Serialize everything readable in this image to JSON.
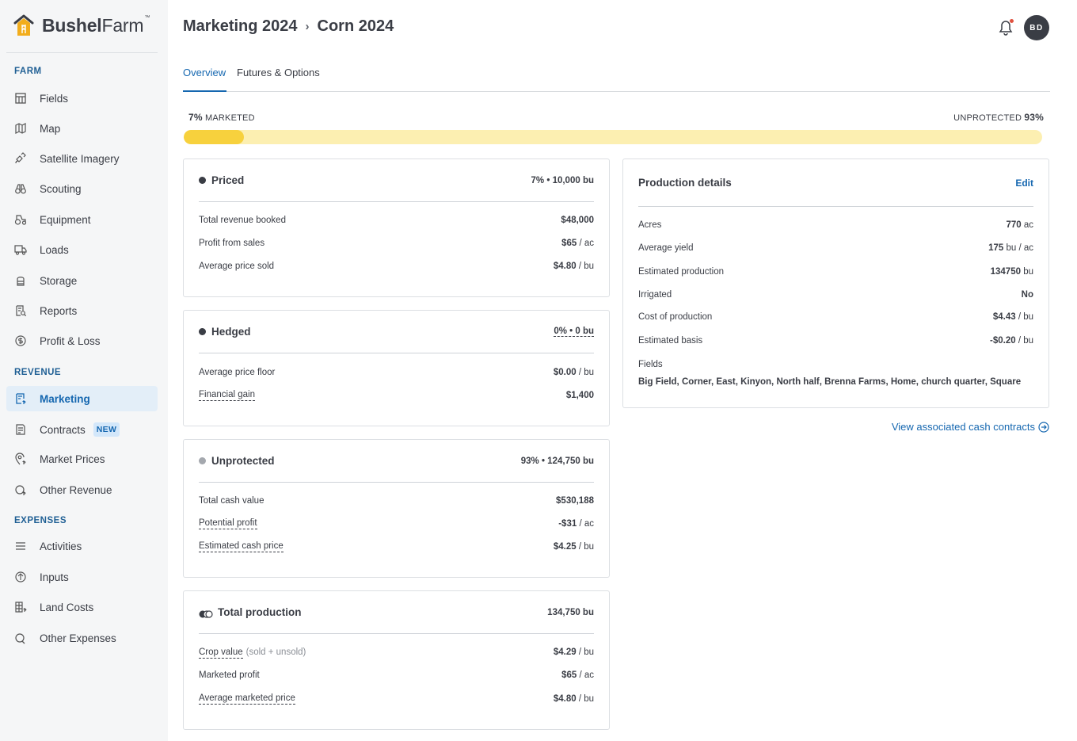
{
  "brand": {
    "name_bold": "Bushel",
    "name_light": "Farm",
    "tm": "™"
  },
  "sidebar": {
    "farm_title": "FARM",
    "farm_items": [
      "Fields",
      "Map",
      "Satellite Imagery",
      "Scouting",
      "Equipment",
      "Loads",
      "Storage",
      "Reports",
      "Profit & Loss"
    ],
    "revenue_title": "REVENUE",
    "revenue_items": [
      "Marketing",
      "Contracts",
      "Market Prices",
      "Other Revenue"
    ],
    "new_badge": "NEW",
    "expenses_title": "EXPENSES",
    "expenses_items": [
      "Activities",
      "Inputs",
      "Land Costs",
      "Other Expenses"
    ]
  },
  "header": {
    "crumb1": "Marketing 2024",
    "sep": "›",
    "crumb2": "Corn 2024",
    "avatar_initials": "BD"
  },
  "tabs": {
    "overview": "Overview",
    "futures": "Futures & Options"
  },
  "progress": {
    "marketed_pct": "7%",
    "marketed_label": "MARKETED",
    "unprotected_label": "UNPROTECTED",
    "unprotected_pct": "93%",
    "fill_fraction": 0.07
  },
  "priced": {
    "title": "Priced",
    "summary": "7% • 10,000 bu",
    "r1_label": "Total revenue booked",
    "r1_val": "$48,000",
    "r1_unit": "",
    "r2_label": "Profit from sales",
    "r2_val": "$65",
    "r2_unit": "/ ac",
    "r3_label": "Average price sold",
    "r3_val": "$4.80",
    "r3_unit": "/ bu"
  },
  "hedged": {
    "title": "Hedged",
    "summary": "0% • 0 bu",
    "r1_label": "Average price floor",
    "r1_val": "$0.00",
    "r1_unit": "/ bu",
    "r2_label": "Financial gain",
    "r2_val": "$1,400"
  },
  "unprotected": {
    "title": "Unprotected",
    "summary": "93% • 124,750 bu",
    "r1_label": "Total cash value",
    "r1_val": "$530,188",
    "r2_label": "Potential profit",
    "r2_val": "-$31",
    "r2_unit": "/ ac",
    "r3_label": "Estimated cash price",
    "r3_val": "$4.25",
    "r3_unit": "/ bu"
  },
  "total": {
    "title": "Total production",
    "summary": "134,750 bu",
    "r1_label": "Crop value",
    "r1_muted": "(sold + unsold)",
    "r1_val": "$4.29",
    "r1_unit": "/ bu",
    "r2_label": "Marketed profit",
    "r2_val": "$65",
    "r2_unit": "/ ac",
    "r3_label": "Average marketed price",
    "r3_val": "$4.80",
    "r3_unit": "/ bu"
  },
  "production": {
    "title": "Production details",
    "edit": "Edit",
    "acres_label": "Acres",
    "acres_val": "770",
    "acres_unit": "ac",
    "yield_label": "Average yield",
    "yield_val": "175",
    "yield_unit": "bu / ac",
    "est_label": "Estimated production",
    "est_val": "134750",
    "est_unit": "bu",
    "irr_label": "Irrigated",
    "irr_val": "No",
    "cost_label": "Cost of production",
    "cost_val": "$4.43",
    "cost_unit": "/ bu",
    "basis_label": "Estimated basis",
    "basis_val": "-$0.20",
    "basis_unit": "/ bu",
    "fields_label": "Fields",
    "fields_val": "Big Field, Corner, East, Kinyon, North half, Brenna Farms, Home, church quarter, Square"
  },
  "cash_link": "View associated cash contracts",
  "colors": {
    "accent": "#1567b0",
    "progress_fill": "#f7d13d",
    "progress_track": "#fcefb1",
    "sidebar_bg": "#f5f6f7"
  }
}
